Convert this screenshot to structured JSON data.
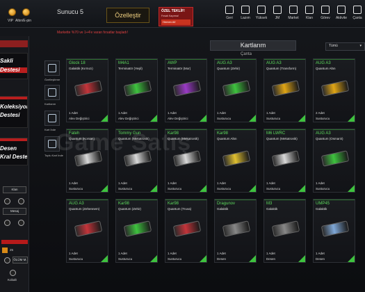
{
  "topbar": {
    "vip_label": "VIP",
    "currency_label": "Altın/E-pin",
    "server": "Sunucu 5",
    "customize_label": "Özelleştir",
    "offer": {
      "title": "ÖZEL TEKLİF!",
      "subtitle": "Fırsatı Kaçırma!",
      "button": "Hemen Al!"
    },
    "nav": [
      {
        "label": "Geri",
        "icon": "back-icon"
      },
      {
        "label": "Lazım",
        "icon": "tools-icon"
      },
      {
        "label": "Yüksek",
        "icon": "upgrade-icon"
      },
      {
        "label": "JM",
        "icon": "jm-icon"
      },
      {
        "label": "Market",
        "icon": "market-icon"
      },
      {
        "label": "Klan",
        "icon": "clan-icon"
      },
      {
        "label": "Görev",
        "icon": "mission-icon"
      },
      {
        "label": "Aktivite",
        "icon": "activity-icon"
      },
      {
        "label": "Çanta",
        "icon": "bag-icon"
      }
    ]
  },
  "promo_text": "Markette %70 ve 1+4'e varan fırsatlar başladı!",
  "left_panel": {
    "banner1": [
      "Sakli",
      "Destesi"
    ],
    "banner2": [
      "Koleksiyon",
      "Destesi"
    ],
    "banner3": [
      "Desen",
      "Kral Deste"
    ],
    "klan_label": "Klan",
    "mesaj_label": "Mesaj",
    "count": "25",
    "dead_label": "ÖLÜM M.",
    "kobalt_label": "Kobalt"
  },
  "main": {
    "title": "Kartlarım",
    "subtitle": "Çanta",
    "filter_value": "Tümü",
    "tools": [
      {
        "label": "Özelleştirme"
      },
      {
        "label": "Kartlarım"
      },
      {
        "label": "Kart İnde"
      },
      {
        "label": "Toplu Kart İnde"
      }
    ],
    "watermark": "Game Satış"
  },
  "cards": [
    {
      "name": "Glock 18",
      "sub": "Galaktik (Kırmızı)",
      "qty": "1 Adet",
      "type": "Alev Değiştirici",
      "color": "#c4343a"
    },
    {
      "name": "M4A1",
      "sub": "Terminatör (Yeşil)",
      "qty": "1 Adet",
      "type": "Alev Değiştirici",
      "color": "#3ec23e"
    },
    {
      "name": "AWP",
      "sub": "Terminatör (Mor)",
      "qty": "1 Adet",
      "type": "Alev Değiştirici",
      "color": "#9a3ac6"
    },
    {
      "name": "AUG A3",
      "sub": "Quantum (Zehir)",
      "qty": "1 Adet",
      "type": "Susturucu",
      "color": "#3ec23e"
    },
    {
      "name": "AUG A3",
      "sub": "Quantum (Transform)",
      "qty": "1 Adet",
      "type": "Susturucu",
      "color": "#e0a515"
    },
    {
      "name": "AUG A3",
      "sub": "Quantum Altın",
      "qty": "2 Adet",
      "type": "Susturucu",
      "color": "#e0a515"
    },
    {
      "name": "Fateh",
      "sub": "Quantum (Korsan)",
      "qty": "1 Adet",
      "type": "Susturucu",
      "color": "#d8d8d8"
    },
    {
      "name": "Tommy Gun",
      "sub": "Quantum (Mekatronik)",
      "qty": "1 Adet",
      "type": "Susturucu",
      "color": "#d8d8d8"
    },
    {
      "name": "Kar98",
      "sub": "Quantum (Mekatronik)",
      "qty": "1 Adet",
      "type": "Susturucu",
      "color": "#d8d8d8"
    },
    {
      "name": "Kar98",
      "sub": "Quantum Altın",
      "qty": "1 Adet",
      "type": "Susturucu",
      "color": "#e0c030"
    },
    {
      "name": "M6 LWRC",
      "sub": "Quantum (Mekatronik)",
      "qty": "1 Adet",
      "type": "Susturucu",
      "color": "#d8d8d8"
    },
    {
      "name": "AUG A3",
      "sub": "Quantum (Osmanlı)",
      "qty": "1 Adet",
      "type": "Susturucu",
      "color": "#3ec23e"
    },
    {
      "name": "AUG A3",
      "sub": "Quantum (Zehennem)",
      "qty": "1 Adet",
      "type": "Susturucu",
      "color": "#c4343a"
    },
    {
      "name": "Kar98",
      "sub": "Quantum (Zehir)",
      "qty": "1 Adet",
      "type": "Susturucu",
      "color": "#3ec23e"
    },
    {
      "name": "Kar98",
      "sub": "Quantum (Truva)",
      "qty": "1 Adet",
      "type": "Susturucu",
      "color": "#c4343a"
    },
    {
      "name": "Dragunov",
      "sub": "Galaktik",
      "qty": "1 Adet",
      "type": "Desen",
      "color": "#888888"
    },
    {
      "name": "M3",
      "sub": "Galaktik",
      "qty": "1 Adet",
      "type": "Desen",
      "color": "#888888"
    },
    {
      "name": "UMP45",
      "sub": "Galaktik",
      "qty": "1 Adet",
      "type": "Desen",
      "color": "#7fa8d8"
    }
  ]
}
